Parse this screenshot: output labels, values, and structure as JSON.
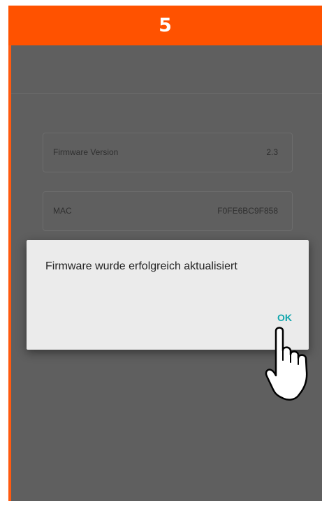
{
  "step": {
    "number": "5"
  },
  "info": {
    "firmware_label": "Firmware Version",
    "firmware_value": "2.3",
    "mac_label": "MAC",
    "mac_value": "F0FE6BC9F858"
  },
  "dialog": {
    "message": "Firmware wurde erfolgreich aktualisiert",
    "ok_label": "OK"
  },
  "colors": {
    "step_bar": "#ff5200",
    "accent_teal": "#11a6ad",
    "overlay_gray": "#5f5f5f",
    "dialog_background": "#ebebeb"
  },
  "icons": {
    "pointer": "hand-pointer-icon"
  }
}
